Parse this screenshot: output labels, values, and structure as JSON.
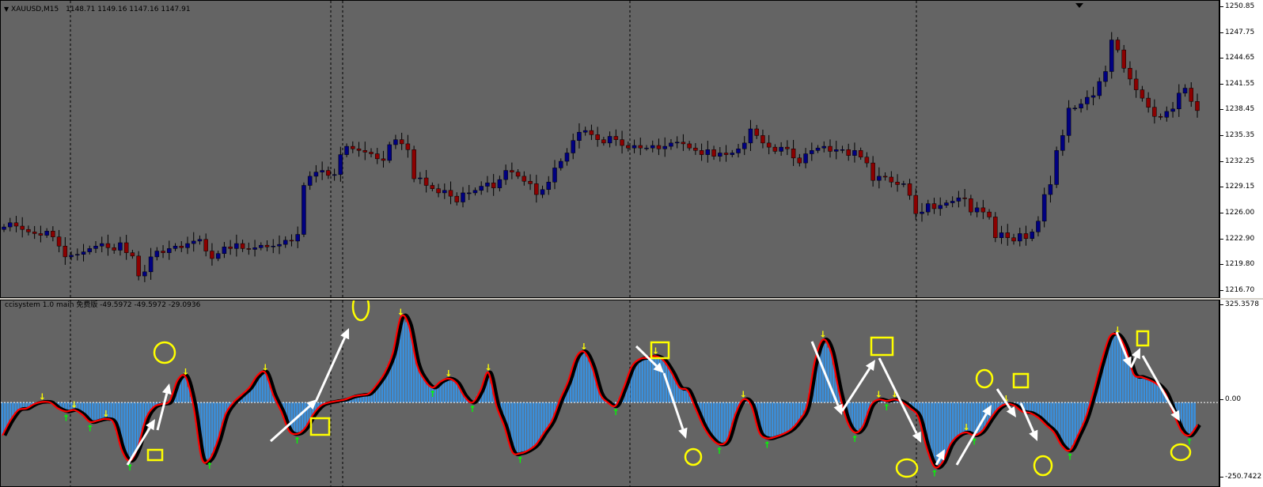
{
  "main": {
    "symbol": "XAUUSD,M15",
    "ohlc": "1148.71 1149.16 1147.16 1147.91",
    "price_ticks": [
      "1250.85",
      "1247.75",
      "1244.65",
      "1241.55",
      "1238.45",
      "1235.35",
      "1232.25",
      "1229.15",
      "1226.00",
      "1222.90",
      "1219.80",
      "1216.70"
    ]
  },
  "indicator": {
    "label": "ccisystem 1.0 main 免费版 -49.5972 -49.5972 -29.0936",
    "axis_top": "325.3578",
    "axis_zero": "0.00",
    "axis_bottom": "-250.7422"
  },
  "colors": {
    "background": "#646464",
    "bull_candle": "#000080",
    "bear_candle": "#8b0000",
    "histogram": "#3a8fdc",
    "line_fast": "#ff0000",
    "line_slow": "#000000",
    "arrow_up": "#00ff00",
    "arrow_down": "#ffff00",
    "annotation": "#ffff00"
  },
  "chart_data": [
    {
      "type": "candlestick",
      "title": "XAUUSD,M15",
      "ylim": [
        1216.7,
        1250.85
      ],
      "series": [
        {
          "values": [
            1224.4,
            1224.9,
            1224.5,
            1224.1,
            1223.8,
            1223.6,
            1223.4,
            1223.9,
            1223.2,
            1222.1,
            1220.8,
            1221.0,
            1221.1,
            1221.4,
            1221.8,
            1222.1,
            1222.4,
            1221.9,
            1221.6,
            1222.5,
            1221.3,
            1220.9,
            1218.5,
            1219.0,
            1220.8,
            1221.5,
            1221.3,
            1221.8,
            1222.1,
            1221.9,
            1222.4,
            1222.7,
            1222.9,
            1221.5,
            1220.6,
            1221.2,
            1222.0,
            1221.8,
            1222.4,
            1221.8,
            1221.7,
            1221.9,
            1222.2,
            1222.0,
            1222.1,
            1222.3,
            1222.8,
            1222.7,
            1223.5,
            1229.4,
            1230.5,
            1231.0,
            1231.2,
            1230.6,
            1230.7,
            1233.1,
            1234.1,
            1233.8,
            1233.6,
            1233.4,
            1233.2,
            1232.6,
            1232.4,
            1234.3,
            1234.9,
            1234.4,
            1233.7,
            1230.2,
            1230.3,
            1229.4,
            1229.0,
            1228.5,
            1228.8,
            1228.1,
            1227.4,
            1228.5,
            1228.5,
            1228.8,
            1229.3,
            1229.7,
            1229.1,
            1230.1,
            1231.2,
            1231.0,
            1230.5,
            1229.9,
            1229.6,
            1228.3,
            1228.9,
            1229.8,
            1231.5,
            1232.3,
            1233.3,
            1234.8,
            1235.8,
            1236.0,
            1235.5,
            1234.9,
            1234.5,
            1235.3,
            1234.9,
            1234.2,
            1233.9,
            1234.2,
            1233.9,
            1233.9,
            1234.2,
            1233.8,
            1234.1,
            1234.5,
            1234.6,
            1234.4,
            1233.9,
            1233.6,
            1233.1,
            1233.7,
            1232.9,
            1233.3,
            1233.1,
            1233.3,
            1233.8,
            1234.5,
            1236.2,
            1235.4,
            1234.5,
            1234.0,
            1233.5,
            1234.0,
            1233.8,
            1232.7,
            1232.1,
            1233.2,
            1233.6,
            1233.9,
            1234.1,
            1233.5,
            1233.7,
            1233.7,
            1233.0,
            1233.6,
            1232.8,
            1232.1,
            1230.0,
            1230.5,
            1230.4,
            1229.8,
            1229.5,
            1229.6,
            1228.2,
            1226.0,
            1226.2,
            1227.2,
            1226.6,
            1227.0,
            1227.3,
            1227.5,
            1227.9,
            1227.8,
            1226.2,
            1226.7,
            1226.2,
            1225.6,
            1223.1,
            1223.7,
            1223.1,
            1222.7,
            1223.6,
            1223.0,
            1223.8,
            1225.1,
            1228.3,
            1229.5,
            1233.6,
            1235.4,
            1238.7,
            1238.7,
            1239.2,
            1240.0,
            1240.2,
            1241.9,
            1243.1,
            1246.9,
            1245.7,
            1243.5,
            1242.2,
            1240.9,
            1239.9,
            1238.8,
            1237.7,
            1237.6,
            1238.3,
            1238.6,
            1240.5,
            1241.1,
            1239.5,
            1238.4
          ]
        }
      ]
    },
    {
      "type": "line",
      "title": "ccisystem 1.0 main 免费版 -49.5972 -49.5972 -29.0936",
      "ylim": [
        -250.7422,
        325.3578
      ],
      "series": [
        {
          "name": "ccisystem 1.0 main",
          "values": [
            -110,
            -60,
            -25,
            -20,
            -5,
            2,
            0,
            -20,
            -30,
            -25,
            -40,
            -65,
            -60,
            -55,
            -70,
            -160,
            -195,
            -150,
            -55,
            -15,
            -5,
            5,
            75,
            85,
            -15,
            -185,
            -190,
            -130,
            -40,
            0,
            25,
            50,
            90,
            100,
            25,
            -30,
            -95,
            -105,
            -85,
            -40,
            -10,
            0,
            5,
            10,
            20,
            25,
            30,
            60,
            100,
            165,
            285,
            260,
            130,
            75,
            50,
            70,
            80,
            65,
            20,
            0,
            40,
            100,
            -10,
            -80,
            -165,
            -170,
            -160,
            -140,
            -100,
            -60,
            10,
            70,
            150,
            170,
            120,
            30,
            0,
            -10,
            50,
            120,
            145,
            150,
            155,
            140,
            100,
            50,
            40,
            -20,
            -80,
            -120,
            -140,
            -125,
            -40,
            10,
            -10,
            -100,
            -120,
            -115,
            -105,
            -90,
            -60,
            -10,
            140,
            210,
            170,
            40,
            -60,
            -100,
            -80,
            -10,
            10,
            5,
            10,
            0,
            -20,
            -50,
            -150,
            -215,
            -200,
            -140,
            -110,
            -100,
            -110,
            -95,
            -55,
            -20,
            -5,
            -10,
            -30,
            -35,
            -50,
            -75,
            -100,
            -145,
            -160,
            -110,
            -50,
            40,
            140,
            220,
            225,
            180,
            95,
            85,
            75,
            60,
            30,
            -35,
            -95,
            -110,
            -75
          ]
        }
      ]
    }
  ]
}
